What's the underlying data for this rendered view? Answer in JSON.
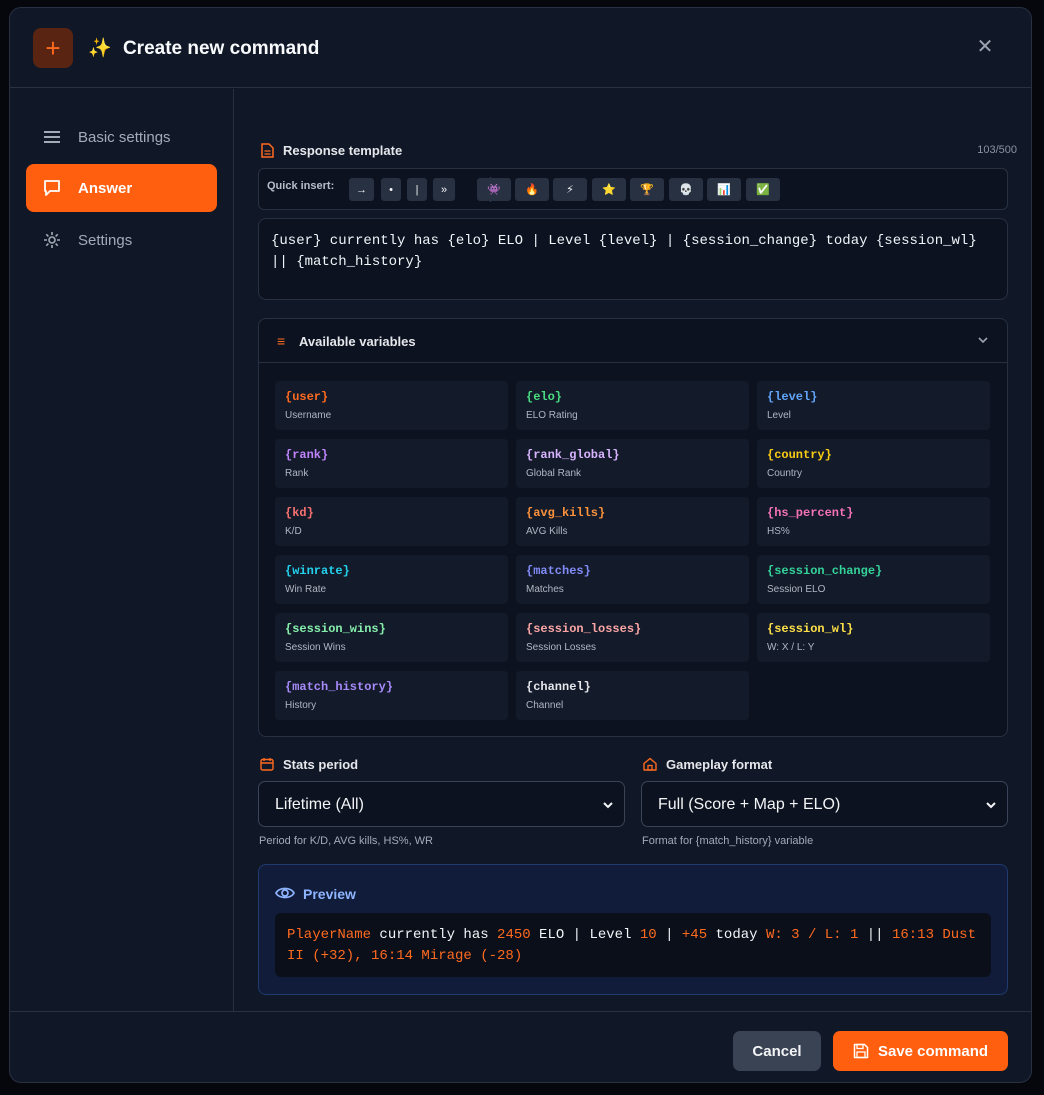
{
  "dialog": {
    "title_emoji": "✨",
    "title": "Create new command",
    "header_icon": "plus-icon",
    "close_icon": "close-icon"
  },
  "sidebar": {
    "items": [
      {
        "label": "Basic settings",
        "icon": "menu-icon",
        "active": false
      },
      {
        "label": "Answer",
        "icon": "chat-bubble-icon",
        "active": true
      },
      {
        "label": "Settings",
        "icon": "gear-icon",
        "active": false
      }
    ]
  },
  "template_section": {
    "label": "Response template",
    "counter": "103/500",
    "quick_insert_label": "Quick insert:",
    "quick_buttons": [
      "→",
      "•",
      "|",
      "»",
      "👾",
      "🔥",
      "⚡",
      "⭐",
      "🏆",
      "💀",
      "📊",
      "✅"
    ],
    "template_value": "{user} currently has {elo} ELO | Level {level} | {session_change} today {session_wl} || {match_history}"
  },
  "variables": {
    "title": "Available variables",
    "items": [
      {
        "code": "{user}",
        "desc": "Username",
        "color": "#ff6a1f"
      },
      {
        "code": "{elo}",
        "desc": "ELO Rating",
        "color": "#4ade80"
      },
      {
        "code": "{level}",
        "desc": "Level",
        "color": "#60a5fa"
      },
      {
        "code": "{rank}",
        "desc": "Rank",
        "color": "#c084fc"
      },
      {
        "code": "{rank_global}",
        "desc": "Global Rank",
        "color": "#d8b4fe"
      },
      {
        "code": "{country}",
        "desc": "Country",
        "color": "#facc15"
      },
      {
        "code": "{kd}",
        "desc": "K/D",
        "color": "#f87171"
      },
      {
        "code": "{avg_kills}",
        "desc": "AVG Kills",
        "color": "#fb923c"
      },
      {
        "code": "{hs_percent}",
        "desc": "HS%",
        "color": "#f472b6"
      },
      {
        "code": "{winrate}",
        "desc": "Win Rate",
        "color": "#22d3ee"
      },
      {
        "code": "{matches}",
        "desc": "Matches",
        "color": "#818cf8"
      },
      {
        "code": "{session_change}",
        "desc": "Session ELO",
        "color": "#34d399"
      },
      {
        "code": "{session_wins}",
        "desc": "Session Wins",
        "color": "#86efac"
      },
      {
        "code": "{session_losses}",
        "desc": "Session Losses",
        "color": "#fca5a5"
      },
      {
        "code": "{session_wl}",
        "desc": "W: X / L: Y",
        "color": "#fde047"
      },
      {
        "code": "{match_history}",
        "desc": "History",
        "color": "#a78bfa"
      },
      {
        "code": "{channel}",
        "desc": "Channel",
        "color": "#e5e7eb"
      }
    ]
  },
  "stats_period": {
    "label": "Stats period",
    "value": "Lifetime (All)",
    "help": "Period for K/D, AVG kills, HS%, WR"
  },
  "gameplay_format": {
    "label": "Gameplay format",
    "value": "Full (Score + Map + ELO)",
    "help": "Format for {match_history} variable"
  },
  "preview": {
    "title": "Preview",
    "parts": {
      "user": "PlayerName",
      "t1": " currently has ",
      "elo": "2450",
      "t2": " ELO | Level ",
      "level": "10",
      "t3": " | ",
      "change": "+45",
      "t4": " today ",
      "wl": "W: 3 / L: 1",
      "t5": " || ",
      "history": "16:13 Dust II (+32), 16:14 Mirage (-28)"
    }
  },
  "footer": {
    "cancel_label": "Cancel",
    "save_label": "Save command"
  }
}
